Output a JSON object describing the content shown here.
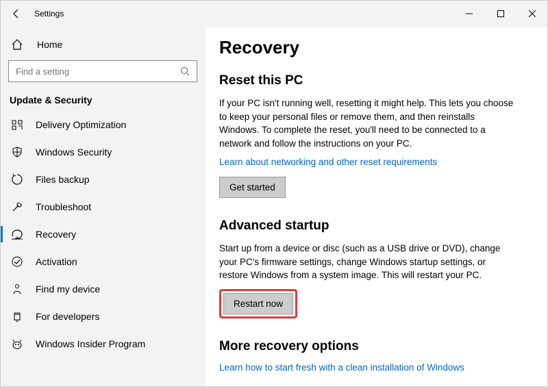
{
  "titlebar": {
    "title": "Settings"
  },
  "sidebar": {
    "home_label": "Home",
    "search_placeholder": "Find a setting",
    "category": "Update & Security",
    "items": [
      {
        "label": "Delivery Optimization"
      },
      {
        "label": "Windows Security"
      },
      {
        "label": "Files backup"
      },
      {
        "label": "Troubleshoot"
      },
      {
        "label": "Recovery"
      },
      {
        "label": "Activation"
      },
      {
        "label": "Find my device"
      },
      {
        "label": "For developers"
      },
      {
        "label": "Windows Insider Program"
      }
    ]
  },
  "content": {
    "page_title": "Recovery",
    "reset": {
      "heading": "Reset this PC",
      "body": "If your PC isn't running well, resetting it might help. This lets you choose to keep your personal files or remove them, and then reinstalls Windows. To complete the reset, you'll need to be connected to a network and follow the instructions on your PC.",
      "link": "Learn about networking and other reset requirements",
      "button": "Get started"
    },
    "advanced": {
      "heading": "Advanced startup",
      "body": "Start up from a device or disc (such as a USB drive or DVD), change your PC's firmware settings, change Windows startup settings, or restore Windows from a system image. This will restart your PC.",
      "button": "Restart now"
    },
    "more": {
      "heading": "More recovery options",
      "link": "Learn how to start fresh with a clean installation of Windows"
    }
  }
}
